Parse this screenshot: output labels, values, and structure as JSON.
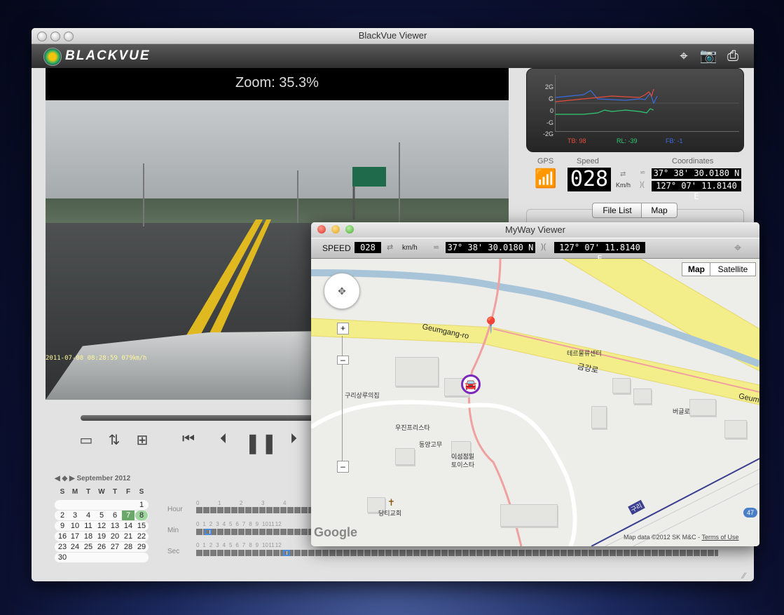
{
  "window": {
    "title": "BlackVue Viewer",
    "logo": "BLACKVUE"
  },
  "toolbar": {
    "icons": [
      "gps-target-icon",
      "camera-icon",
      "printer-icon"
    ]
  },
  "video": {
    "zoom": "Zoom: 35.3%",
    "timestamp": "2011-07-08 08:28:59  079㎞/h"
  },
  "gsensor": {
    "ticks": [
      "2G",
      "G",
      "0",
      "-G",
      "-2G"
    ],
    "tb": "TB: 98",
    "rl": "RL: -39",
    "fb": "FB: -1",
    "colors": {
      "tb": "#e74c3c",
      "rl": "#2ecc71",
      "fb": "#3b6de0"
    }
  },
  "gps": {
    "gps_label": "GPS",
    "speed_label": "Speed",
    "speed": "028",
    "unit": "Km/h",
    "coords_label": "Coordinates",
    "lat": "37° 38' 30.0180 N",
    "lon": "127° 07' 11.8140 E"
  },
  "tabs": {
    "file_list": "File List",
    "map": "Map"
  },
  "calendar": {
    "month": "September 2012",
    "dow": [
      "S",
      "M",
      "T",
      "W",
      "T",
      "F",
      "S"
    ],
    "weeks": [
      [
        "",
        "",
        "",
        "",
        "",
        "",
        "1"
      ],
      [
        "2",
        "3",
        "4",
        "5",
        "6",
        "7",
        "8"
      ],
      [
        "9",
        "10",
        "11",
        "12",
        "13",
        "14",
        "15"
      ],
      [
        "16",
        "17",
        "18",
        "19",
        "20",
        "21",
        "22"
      ],
      [
        "23",
        "24",
        "25",
        "26",
        "27",
        "28",
        "29"
      ],
      [
        "30",
        "",
        "",
        "",
        "",
        "",
        ""
      ]
    ],
    "highlight": {
      "day7": "#6aa86a",
      "day8": "#9fd69f"
    }
  },
  "timeline": {
    "hour": "Hour",
    "min": "Min",
    "sec": "Sec",
    "hour_ticks": [
      "0",
      "1",
      "2",
      "3",
      "4"
    ],
    "min_ticks": [
      "0",
      "1",
      "2",
      "3",
      "4",
      "5",
      "6",
      "7",
      "8",
      "9",
      "10",
      "11",
      "12"
    ],
    "sec_ticks": [
      "0",
      "1",
      "2",
      "3",
      "4",
      "5",
      "6",
      "7",
      "8",
      "9",
      "10",
      "11",
      "12"
    ]
  },
  "myway": {
    "title": "MyWay Viewer",
    "speed_label": "SPEED",
    "speed": "028",
    "unit": "km/h",
    "lat": "37° 38' 30.0180 N",
    "lon": "127° 07' 11.8140 E",
    "map_btn": "Map",
    "satellite_btn": "Satellite",
    "road1": "Geumgang-ro",
    "road1_kr": "금강로",
    "road1_cut": "Geum",
    "labels": [
      "테르물류센터",
      "구리상루의집",
      "우진프리스타",
      "동양고무",
      "이성정밀",
      "토이스타",
      "버글로",
      "당티교회",
      "구리"
    ],
    "route_badge": "47",
    "google": "Google",
    "map_data": "Map data ©2012 SK M&C - ",
    "terms": "Terms of Use"
  }
}
